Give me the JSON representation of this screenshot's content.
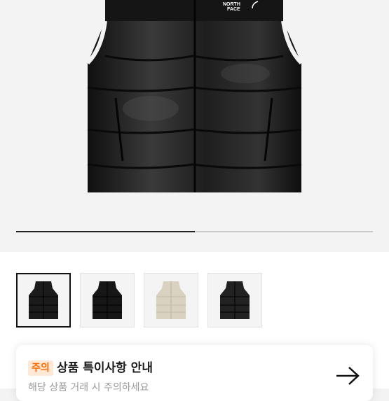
{
  "product": {
    "brand_text_line1": "NORTH",
    "brand_text_line2": "FACE",
    "gallery_progress": 0.5
  },
  "thumbnails": [
    {
      "label": "black-shiny-vest",
      "color": "#1b1b1b",
      "selected": true
    },
    {
      "label": "black-matte-vest",
      "color": "#161616",
      "selected": false
    },
    {
      "label": "beige-vest",
      "color": "#d9d2c0",
      "selected": false
    },
    {
      "label": "black-dark-vest",
      "color": "#222222",
      "selected": false
    }
  ],
  "notice": {
    "badge": "주의",
    "title": "상품 특이사항 안내",
    "description": "해당 상품 거래 시 주의하세요"
  },
  "colors": {
    "badge_bg": "#ffe8d6",
    "badge_text": "#ff6a00",
    "background": "#f3f3f4"
  }
}
